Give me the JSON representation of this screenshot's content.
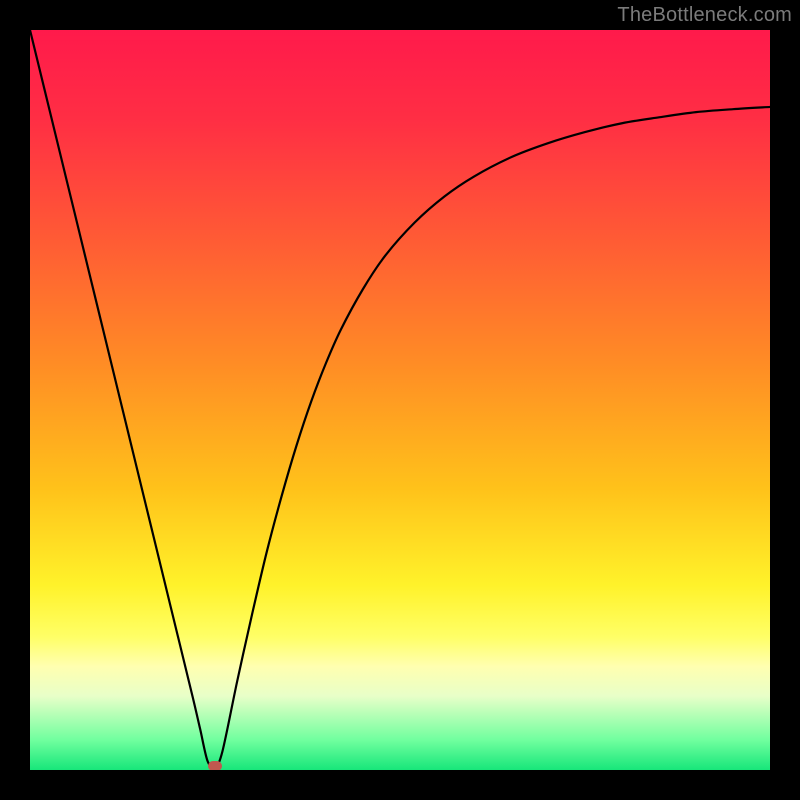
{
  "watermark": "TheBottleneck.com",
  "chart_data": {
    "type": "line",
    "title": "",
    "xlabel": "",
    "ylabel": "",
    "xlim": [
      0,
      100
    ],
    "ylim": [
      0,
      100
    ],
    "grid": false,
    "gradient_stops": [
      {
        "offset": 0,
        "color": "#ff1a4b"
      },
      {
        "offset": 12,
        "color": "#ff2e44"
      },
      {
        "offset": 28,
        "color": "#ff5a35"
      },
      {
        "offset": 45,
        "color": "#ff8c25"
      },
      {
        "offset": 62,
        "color": "#ffc21a"
      },
      {
        "offset": 75,
        "color": "#fff22a"
      },
      {
        "offset": 82,
        "color": "#ffff66"
      },
      {
        "offset": 86,
        "color": "#ffffb0"
      },
      {
        "offset": 90,
        "color": "#e8ffc8"
      },
      {
        "offset": 96,
        "color": "#6fff9e"
      },
      {
        "offset": 100,
        "color": "#17e67a"
      }
    ],
    "series": [
      {
        "name": "bottleneck-curve",
        "x": [
          0,
          2,
          4,
          6,
          8,
          10,
          12,
          14,
          16,
          18,
          20,
          22,
          23,
          24,
          25,
          26,
          28,
          30,
          32,
          34,
          36,
          38,
          40,
          42,
          45,
          48,
          52,
          56,
          60,
          65,
          70,
          75,
          80,
          85,
          90,
          95,
          100
        ],
        "values": [
          100,
          91.8,
          83.6,
          75.4,
          67.2,
          59.0,
          50.8,
          42.6,
          34.4,
          26.2,
          18.0,
          9.8,
          5.5,
          1.2,
          0.4,
          2.5,
          12.0,
          21.0,
          29.5,
          37.0,
          43.8,
          49.8,
          55.0,
          59.5,
          65.0,
          69.5,
          74.0,
          77.5,
          80.2,
          82.8,
          84.7,
          86.2,
          87.4,
          88.2,
          88.9,
          89.3,
          89.6
        ]
      }
    ],
    "marker": {
      "x": 25,
      "y": 0.5,
      "color": "#c0584f"
    },
    "curve_stroke": "#000000",
    "curve_width": 2.2
  }
}
